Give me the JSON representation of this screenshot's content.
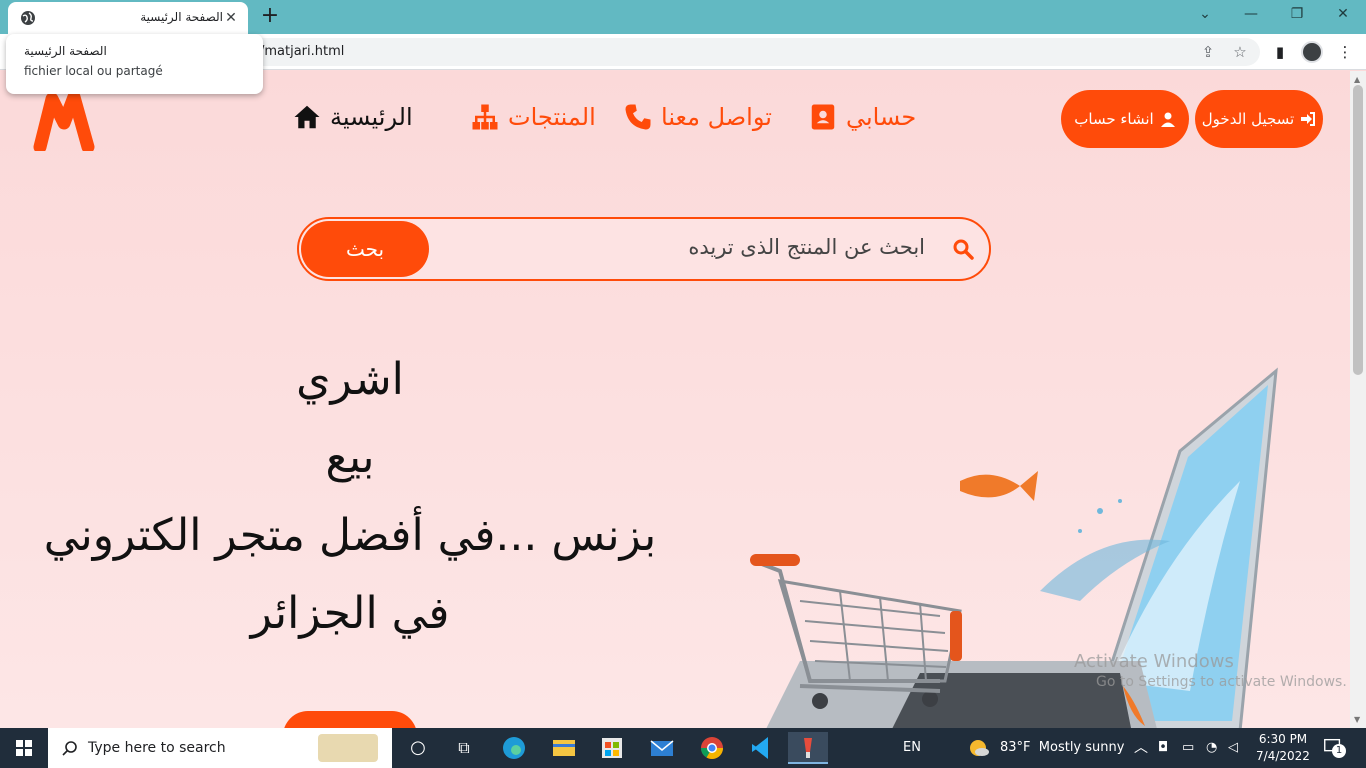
{
  "browser": {
    "tab_title": "الصفحة الرئيسية",
    "url": "/matjari.html",
    "tooltip_title": "الصفحة الرئيسية",
    "tooltip_subtitle": "fichier local ou partagé"
  },
  "nav": {
    "home": "الرئيسية",
    "products": "المنتجات",
    "contact": "تواصل معنا",
    "account": "حسابي",
    "signup": "انشاء حساب",
    "login": "تسجيل الدخول"
  },
  "search": {
    "placeholder": "ابحث عن المنتج الذى تريده",
    "button": "بحث"
  },
  "hero": {
    "line1": "اشري",
    "line2": "بيع",
    "line3": "بزنس ...في أفضل متجر الكتروني",
    "line4": "في الجزائر"
  },
  "watermark": {
    "title": "Activate Windows",
    "subtitle": "Go to Settings to activate Windows."
  },
  "taskbar": {
    "search_placeholder": "Type here to search",
    "lang": "EN",
    "weather": "83°F  Mostly sunny",
    "time": "6:30 PM",
    "date": "7/4/2022",
    "notif_count": "1"
  },
  "colors": {
    "accent": "#ff4b0a",
    "tabstrip": "#62b9c2",
    "page_bg": "#fbdada"
  }
}
